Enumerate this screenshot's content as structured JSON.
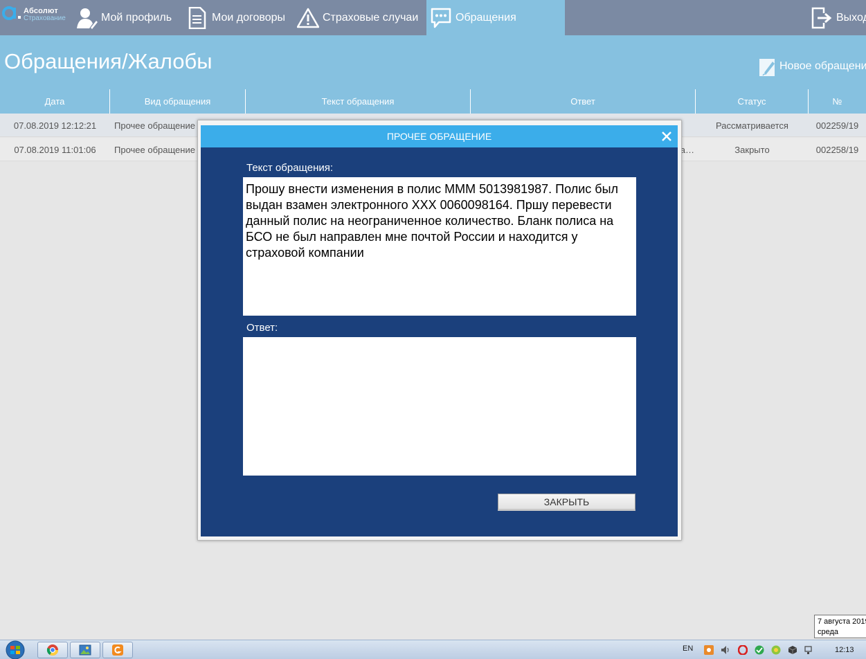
{
  "brand": {
    "title": "Абсолют",
    "subtitle": "Страхование"
  },
  "nav": {
    "profile": "Мой профиль",
    "contracts": "Мои договоры",
    "cases": "Страховые случаи",
    "appeals": "Обращения",
    "logout": "Выход"
  },
  "page": {
    "title": "Обращения/Жалобы",
    "new_appeal": "Новое обращение"
  },
  "table": {
    "headers": [
      "Дата",
      "Вид обращения",
      "Текст обращения",
      "Ответ",
      "Статус",
      "№"
    ],
    "rows": [
      {
        "date": "07.08.2019 12:12:21",
        "type": "Прочее обращение",
        "text": "",
        "answer": "",
        "status": "Рассматривается",
        "number": "002259/19"
      },
      {
        "date": "07.08.2019 11:01:06",
        "type": "Прочее обращение",
        "text": "",
        "answer": "а…",
        "status": "Закрыто",
        "number": "002258/19"
      }
    ]
  },
  "modal": {
    "title": "ПРОЧЕЕ ОБРАЩЕНИЕ",
    "text_label": "Текст обращения:",
    "text_value": "Прошу внести изменения в полис МММ 5013981987. Полис был выдан взамен электронного ХХХ 0060098164. Пршу перевести данный полис на неограниченное количество. Бланк полиса на БСО не был направлен мне почтой России и находится у страховой компании",
    "answer_label": "Ответ:",
    "answer_value": "",
    "close_button": "ЗАКРЫТЬ"
  },
  "tooltip": {
    "date_line": "7 августа 2019",
    "weekday": "среда"
  },
  "taskbar": {
    "lang": "EN",
    "time": "12:13"
  },
  "colors": {
    "nav_bg": "#7b8aa3",
    "accent": "#86c1e0",
    "modal_bg": "#1b407c",
    "modal_header": "#3badea"
  },
  "icons": [
    "logo-mark-icon",
    "user-icon",
    "document-icon",
    "warning-icon",
    "chat-icon",
    "logout-icon",
    "edit-icon",
    "close-icon"
  ]
}
